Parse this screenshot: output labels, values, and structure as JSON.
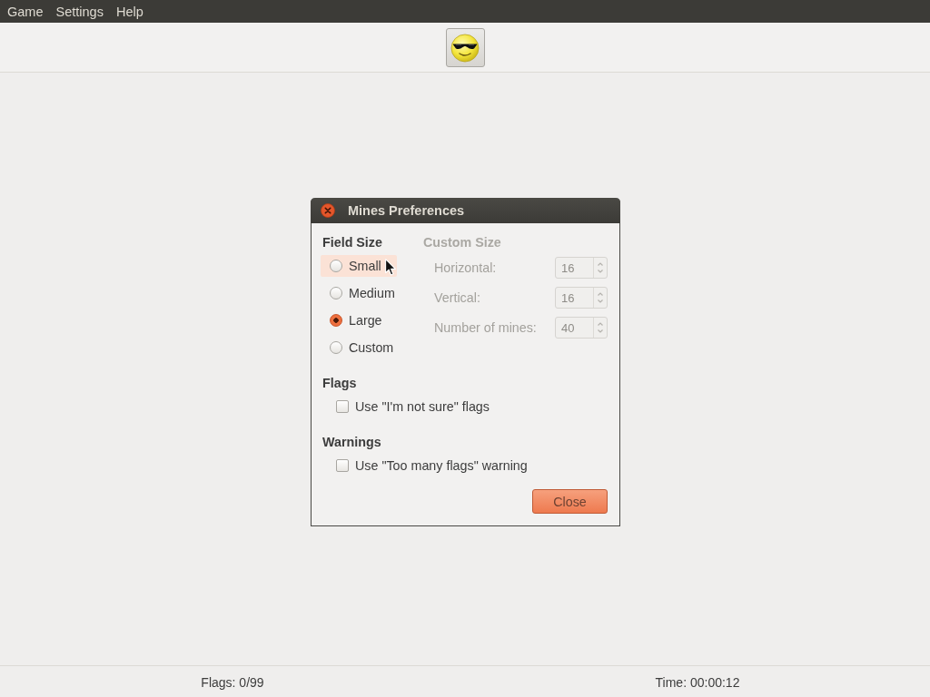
{
  "menu": [
    "Game",
    "Settings",
    "Help"
  ],
  "dialog": {
    "title": "Mines Preferences",
    "field_size": {
      "heading": "Field Size",
      "options": [
        {
          "label": "Small",
          "selected": false,
          "hovered": true
        },
        {
          "label": "Medium",
          "selected": false,
          "hovered": false
        },
        {
          "label": "Large",
          "selected": true,
          "hovered": false
        },
        {
          "label": "Custom",
          "selected": false,
          "hovered": false
        }
      ]
    },
    "custom_size": {
      "heading": "Custom Size",
      "disabled": true,
      "fields": [
        {
          "label": "Horizontal:",
          "value": "16"
        },
        {
          "label": "Vertical:",
          "value": "16"
        },
        {
          "label": "Number of mines:",
          "value": "40"
        }
      ]
    },
    "flags": {
      "heading": "Flags",
      "options": [
        {
          "label": "Use \"I'm not sure\" flags",
          "checked": false
        }
      ]
    },
    "warnings": {
      "heading": "Warnings",
      "options": [
        {
          "label": "Use \"Too many flags\" warning",
          "checked": false
        }
      ]
    },
    "buttons": [
      "Close"
    ]
  },
  "status_bar": {
    "flags": "Flags: 0/99",
    "time": "Time: 00:00:12"
  }
}
